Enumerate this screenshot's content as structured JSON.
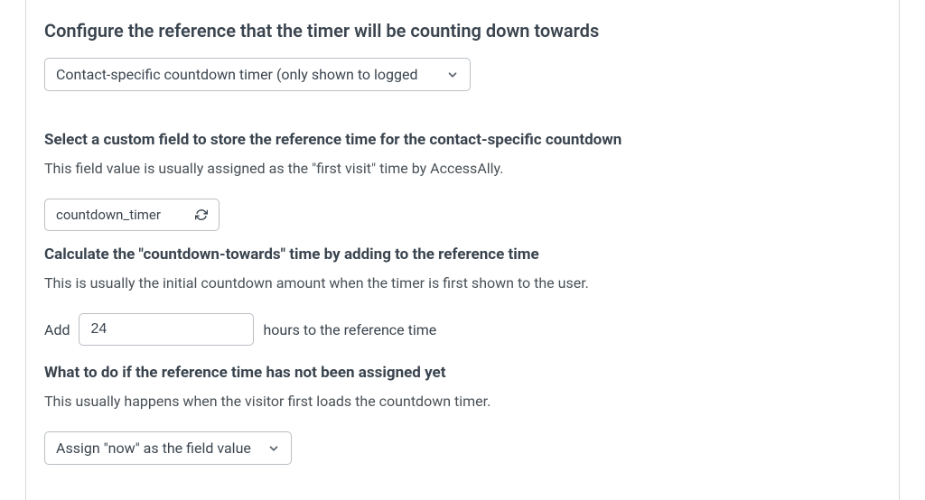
{
  "section1": {
    "heading": "Configure the reference that the timer will be counting down towards",
    "select_value": "Contact-specific countdown timer (only shown to logged"
  },
  "section2": {
    "heading": "Select a custom field to store the reference time for the contact-specific countdown",
    "description": "This field value is usually assigned as the \"first visit\" time by AccessAlly.",
    "field_value": "countdown_timer"
  },
  "section3": {
    "heading": "Calculate the \"countdown-towards\" time by adding to the reference time",
    "description": "This is usually the initial countdown amount when the timer is first shown to the user.",
    "add_label": "Add",
    "hours_value": "24",
    "hours_suffix": "hours to the reference time"
  },
  "section4": {
    "heading": "What to do if the reference time has not been assigned yet",
    "description": "This usually happens when the visitor first loads the countdown timer.",
    "select_value": "Assign \"now\" as the field value"
  }
}
